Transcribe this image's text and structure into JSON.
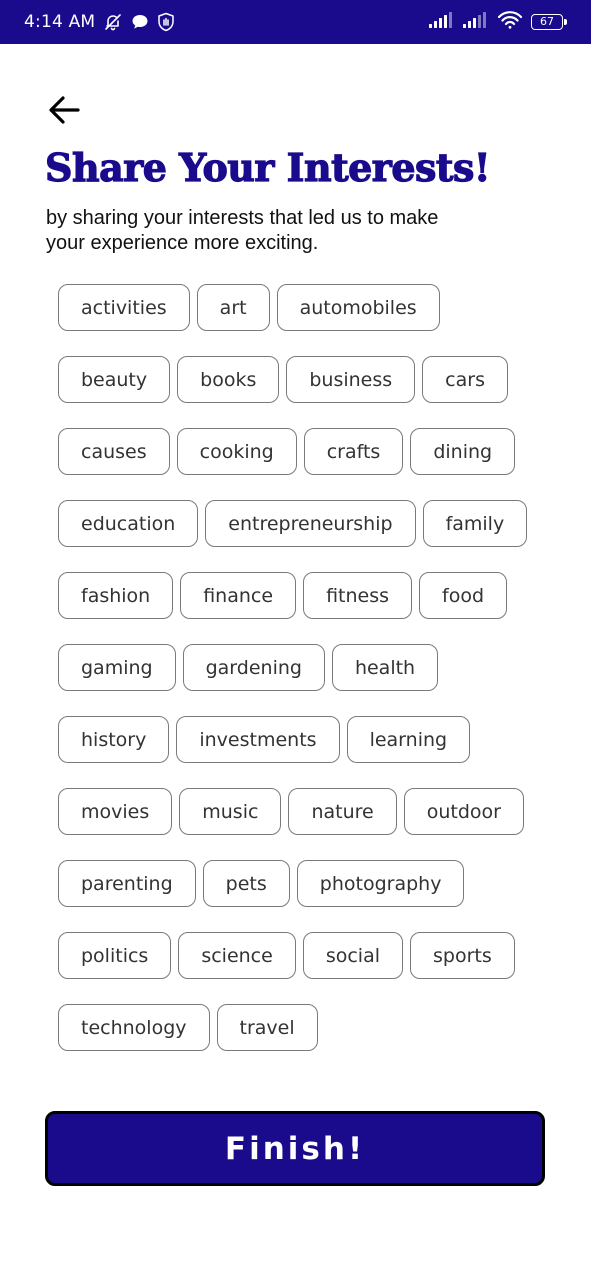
{
  "status_bar": {
    "time": "4:14 AM",
    "battery_level": "67",
    "icons": [
      "muted-bell-icon",
      "chat-bubble-icon",
      "shield-hand-icon",
      "signal-icon",
      "signal-icon",
      "wifi-icon",
      "battery-icon"
    ]
  },
  "header": {
    "back_icon": "arrow-left-icon",
    "title": "Share Your Interests!",
    "subtitle": "by sharing your interests that led us to make your experience more exciting."
  },
  "interests": {
    "rows": [
      [
        "activities",
        "art",
        "automobiles"
      ],
      [
        "beauty",
        "books",
        "business",
        "cars"
      ],
      [
        "causes",
        "cooking",
        "crafts",
        "dining"
      ],
      [
        "education",
        "entrepreneurship",
        "family"
      ],
      [
        "fashion",
        "finance",
        "fitness",
        "food"
      ],
      [
        "gaming",
        "gardening",
        "health"
      ],
      [
        "history",
        "investments",
        "learning"
      ],
      [
        "movies",
        "music",
        "nature",
        "outdoor"
      ],
      [
        "parenting",
        "pets",
        "photography"
      ],
      [
        "politics",
        "science",
        "social",
        "sports"
      ],
      [
        "technology",
        "travel"
      ]
    ]
  },
  "footer": {
    "finish_label": "Finish!"
  },
  "colors": {
    "primary": "#1a0a8c",
    "chip_border": "#7a7a7a",
    "chip_text": "#333333",
    "background": "#ffffff"
  }
}
